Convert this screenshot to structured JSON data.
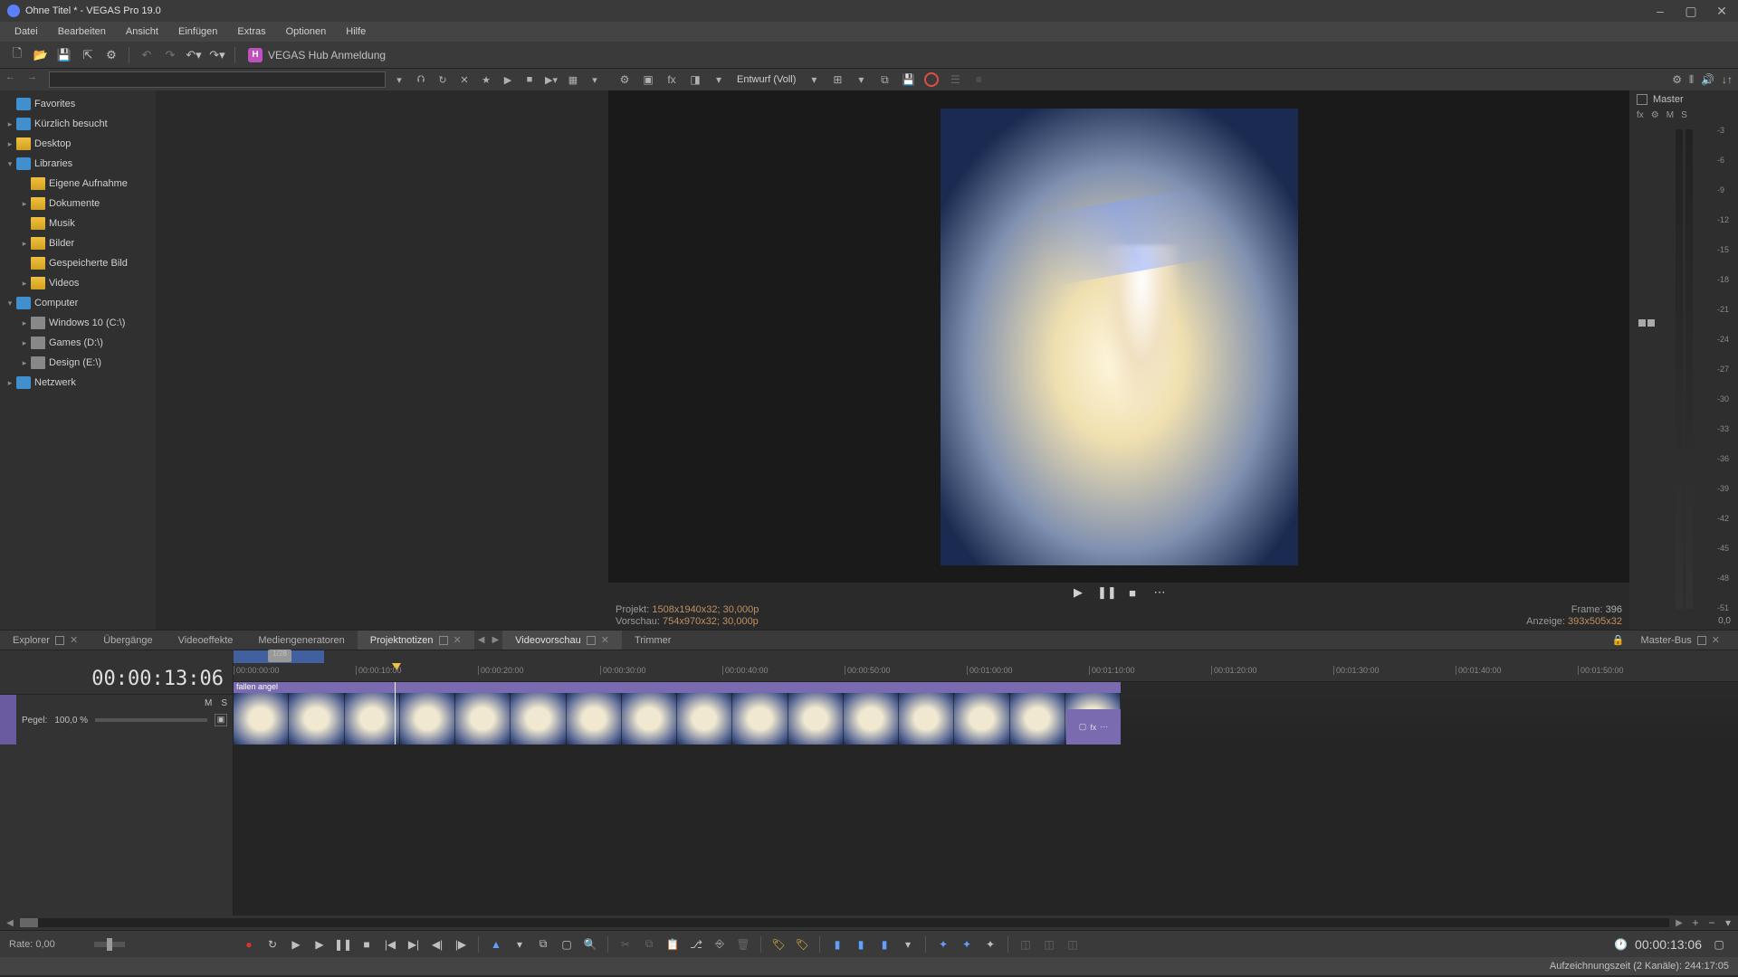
{
  "window_title": "Ohne Titel * - VEGAS Pro 19.0",
  "menus": [
    "Datei",
    "Bearbeiten",
    "Ansicht",
    "Einfügen",
    "Extras",
    "Optionen",
    "Hilfe"
  ],
  "hub_label": "VEGAS Hub Anmeldung",
  "explorer": {
    "tree": [
      {
        "label": "Favorites",
        "lvl": 0,
        "exp": true,
        "icon": "special",
        "toggles": false
      },
      {
        "label": "Kürzlich besucht",
        "lvl": 0,
        "exp": false,
        "icon": "special",
        "toggles": true
      },
      {
        "label": "Desktop",
        "lvl": 0,
        "exp": false,
        "icon": "folder",
        "toggles": true
      },
      {
        "label": "Libraries",
        "lvl": 0,
        "exp": true,
        "icon": "special",
        "toggles": true
      },
      {
        "label": "Eigene Aufnahme",
        "lvl": 1,
        "exp": false,
        "icon": "folder",
        "toggles": false
      },
      {
        "label": "Dokumente",
        "lvl": 1,
        "exp": false,
        "icon": "folder",
        "toggles": true
      },
      {
        "label": "Musik",
        "lvl": 1,
        "exp": false,
        "icon": "folder",
        "toggles": false
      },
      {
        "label": "Bilder",
        "lvl": 1,
        "exp": false,
        "icon": "folder",
        "toggles": true
      },
      {
        "label": "Gespeicherte Bild",
        "lvl": 1,
        "exp": false,
        "icon": "folder",
        "toggles": false
      },
      {
        "label": "Videos",
        "lvl": 1,
        "exp": false,
        "icon": "folder",
        "toggles": true
      },
      {
        "label": "Computer",
        "lvl": 0,
        "exp": true,
        "icon": "special",
        "toggles": true
      },
      {
        "label": "Windows 10 (C:\\)",
        "lvl": 1,
        "exp": false,
        "icon": "drive",
        "toggles": true
      },
      {
        "label": "Games (D:\\)",
        "lvl": 1,
        "exp": false,
        "icon": "drive",
        "toggles": true
      },
      {
        "label": "Design (E:\\)",
        "lvl": 1,
        "exp": false,
        "icon": "drive",
        "toggles": true
      },
      {
        "label": "Netzwerk",
        "lvl": 0,
        "exp": false,
        "icon": "special",
        "toggles": true
      }
    ]
  },
  "preview": {
    "quality_label": "Entwurf (Voll)",
    "projekt_label": "Projekt:",
    "projekt_value": "1508x1940x32; 30,000p",
    "vorschau_label": "Vorschau:",
    "vorschau_value": "754x970x32; 30,000p",
    "anzeige_label": "Anzeige:",
    "anzeige_value": "393x505x32",
    "frame_label": "Frame:",
    "frame_value": "396"
  },
  "panel_tabs": {
    "left": [
      "Explorer",
      "Übergänge",
      "Videoeffekte",
      "Mediengeneratoren",
      "Projektnotizen"
    ],
    "right": [
      "Videovorschau",
      "Trimmer"
    ],
    "master": "Master-Bus",
    "active_left": "Projektnotizen",
    "active_right": "Videovorschau"
  },
  "master": {
    "title": "Master",
    "ctrl1": "fx",
    "ctrl2": "⚙",
    "ctrl3": "M",
    "ctrl4": "S",
    "scale": [
      "-3",
      "-6",
      "-9",
      "-12",
      "-15",
      "-18",
      "-21",
      "-24",
      "-27",
      "-30",
      "-33",
      "-36",
      "-39",
      "-42",
      "-45",
      "-48",
      "-51"
    ],
    "readout": "0,0"
  },
  "timeline": {
    "timecode": "00:00:13:06",
    "clip_name": "fallen angel",
    "track": {
      "m": "M",
      "s": "S",
      "pegel_label": "Pegel:",
      "pegel_value": "100,0 %"
    },
    "ruler_ticks": [
      "00:00:00:00",
      "00:00:10:00",
      "00:00:20:00",
      "00:00:30:00",
      "00:00:40:00",
      "00:00:50:00",
      "00:01:00:00",
      "00:01:10:00",
      "00:01:20:00",
      "00:01:30:00",
      "00:01:40:00",
      "00:01:50:00"
    ],
    "clip_end_icons": [
      "▢",
      "fx",
      "⋯"
    ],
    "overview_knob": "1/28"
  },
  "transport": {
    "rate_label": "Rate:",
    "rate_value": "0,00",
    "timecode_right": "00:00:13:06"
  },
  "status": "Aufzeichnungszeit (2 Kanäle): 244:17:05"
}
